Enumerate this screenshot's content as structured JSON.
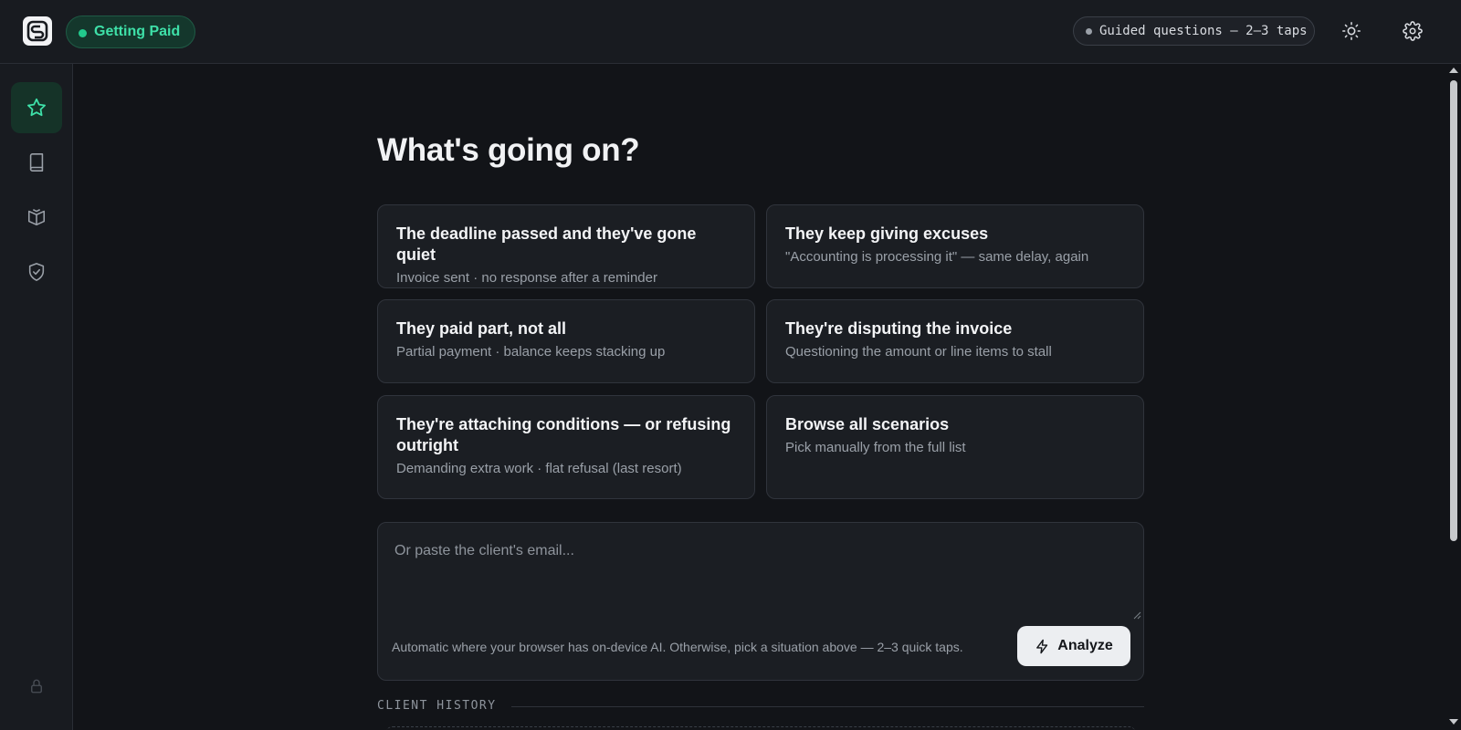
{
  "header": {
    "logo_icon": "app-logo-icon",
    "mode_label": "Getting Paid",
    "mode_status_color": "#22c98c",
    "guided_label": "Guided questions — 2–3 taps",
    "theme_icon": "sun-icon",
    "settings_icon": "gear-icon"
  },
  "sidebar": {
    "items": [
      {
        "name": "star-icon",
        "active": true
      },
      {
        "name": "book-icon",
        "active": false
      },
      {
        "name": "open-book-icon",
        "active": false
      },
      {
        "name": "shield-check-icon",
        "active": false
      }
    ],
    "bottom_icon": "lock-icon"
  },
  "main": {
    "heading": "What's going on?",
    "scenarios": [
      {
        "title": "The deadline passed and they've gone quiet",
        "subtitle": "Invoice sent · no response after a reminder"
      },
      {
        "title": "They keep giving excuses",
        "subtitle": "\"Accounting is processing it\" — same delay, again"
      },
      {
        "title": "They paid part, not all",
        "subtitle": "Partial payment · balance keeps stacking up"
      },
      {
        "title": "They're disputing the invoice",
        "subtitle": "Questioning the amount or line items to stall"
      },
      {
        "title": "They're attaching conditions — or refusing outright",
        "subtitle": "Demanding extra work · flat refusal (last resort)"
      },
      {
        "title": "Browse all scenarios",
        "subtitle": "Pick manually from the full list"
      }
    ],
    "email": {
      "placeholder": "Or paste the client's email...",
      "value": "",
      "hint": "Automatic where your browser has on-device AI. Otherwise, pick a situation above — 2–3 quick taps.",
      "analyze_label": "Analyze",
      "analyze_icon": "lightning-icon"
    },
    "history_label": "CLIENT HISTORY"
  },
  "colors": {
    "accent": "#3ee0a8",
    "background": "#121418",
    "panel": "#181b20"
  }
}
